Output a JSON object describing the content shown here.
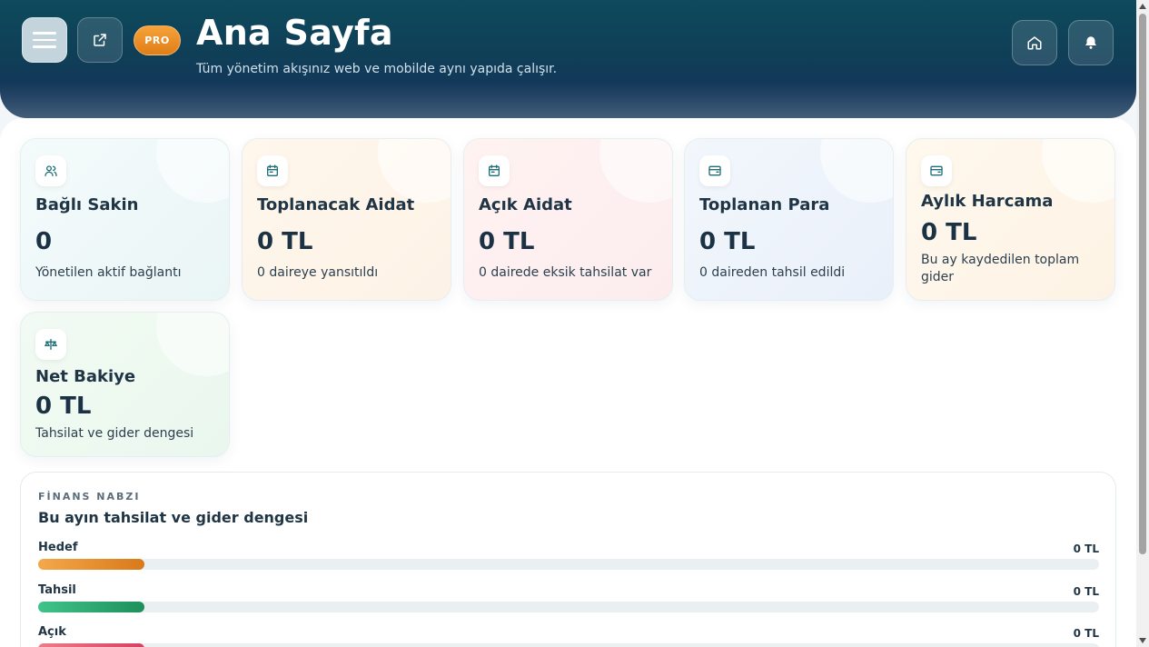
{
  "header": {
    "title": "Ana Sayfa",
    "subtitle": "Tüm yönetim akışınız web ve mobilde aynı yapıda çalışır.",
    "badge": "PRO",
    "icons": [
      "menu-icon",
      "external-link-icon",
      "home-icon",
      "bell-icon"
    ]
  },
  "cards": [
    {
      "title": "Bağlı Sakin",
      "value": "0",
      "desc": "Yönetilen aktif bağlantı",
      "icon": "users-icon"
    },
    {
      "title": "Toplanacak Aidat",
      "value": "0 TL",
      "desc": "0 daireye yansıtıldı",
      "icon": "calendar-icon"
    },
    {
      "title": "Açık Aidat",
      "value": "0 TL",
      "desc": "0 dairede eksik tahsilat var",
      "icon": "calendar-icon"
    },
    {
      "title": "Toplanan Para",
      "value": "0 TL",
      "desc": "0 daireden tahsil edildi",
      "icon": "wallet-icon"
    },
    {
      "title": "Aylık Harcama",
      "value": "0 TL",
      "desc": "Bu ay kaydedilen toplam gider",
      "icon": "wallet-icon"
    },
    {
      "title": "Net Bakiye",
      "value": "0 TL",
      "desc": "Tahsilat ve gider dengesi",
      "icon": "scale-icon"
    }
  ],
  "finance": {
    "eyebrow": "FİNANS NABZI",
    "title": "Bu ayın tahsilat ve gider dengesi",
    "rows": [
      {
        "label": "Hedef",
        "value": "0 TL",
        "color_from": "#f3a94a",
        "color_to": "#d9791a"
      },
      {
        "label": "Tahsil",
        "value": "0 TL",
        "color_from": "#3fc48a",
        "color_to": "#1f8f5a"
      },
      {
        "label": "Açık",
        "value": "0 TL",
        "color_from": "#f07a8a",
        "color_to": "#d64060"
      }
    ]
  },
  "colors": {
    "header": "#0f3f57",
    "accent_pro": "#ee8f26",
    "icon_teal": "#1f6f7a"
  }
}
